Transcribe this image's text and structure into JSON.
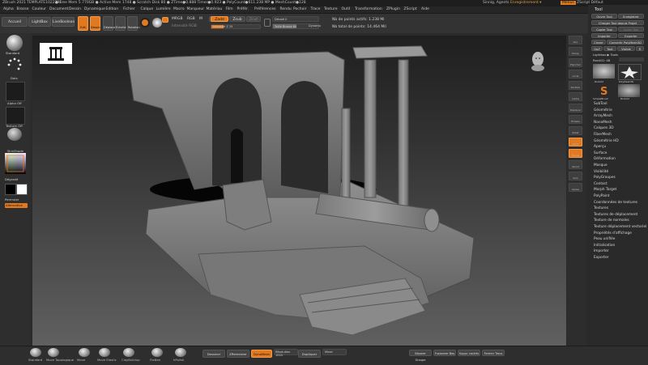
{
  "titlebar": {
    "app": "ZBrush 2021",
    "doc": "TEMPLATE1022291",
    "stats": "● Free Mem 5.770GB ● Active Mem 1748 ● Scratch Disk 80 ● ZTime●0.888 Timer●0.923 ● PolyCount●611.238 MP ● MeshCount●128",
    "right_items": [
      "Sinnig, Agents",
      "Enregistrement ▾",
      "Menus",
      "ZScript Défaut"
    ]
  },
  "menubar": [
    "Alpha",
    "Brosse",
    "Couleur",
    "Document",
    "Dessin",
    "Dynamique",
    "Edition",
    "Fichier",
    "Calque",
    "Lumière",
    "Macro",
    "Marqueur",
    "Matériau",
    "Film",
    "Préfér.",
    "Préférences",
    "Rendu",
    "Pochoir",
    "Trace",
    "Texture",
    "Outil",
    "Transformation",
    "ZPlugin",
    "ZScript",
    "Aide"
  ],
  "topshelf": {
    "tabs": [
      "Accueil",
      "LightBox",
      "LiveBoolean"
    ],
    "tools": [
      "Edit",
      "Dessin",
      "Déplacer",
      "Échelle",
      "Rotation"
    ],
    "mrgb": "MRGB",
    "rgb": "RGB",
    "m": "M",
    "zadd": "Zadd",
    "zsub": "Zsub",
    "zcut": "Zcut",
    "rgb_intensity_label": "Intensité RGB",
    "z_intensity_label": "Intensité Z 25",
    "focal_label": "Décalé 0",
    "draw_size_label": "Taille Brosse 64",
    "dynamic_label": "Dynamic",
    "points_active": "Nb de points actifs: 1.238 Mi",
    "points_total": "Nb total de points: 14.464 Mil"
  },
  "leftshelf": {
    "brush_label": "Standard",
    "stroke_label": "Dots",
    "alpha_label": "Alpha Off",
    "texture_label": "Texture Off",
    "material_label": "SkinShade",
    "gradient_label": "Dégradé",
    "switch_label": "Permuter",
    "alternate_label": "Alternative"
  },
  "rightshelf": [
    "Doc",
    "Persp",
    "Plancher",
    "Local",
    "Position",
    "Cadre",
    "Déplacer",
    "Échelle",
    "Rotat",
    "Polyf",
    "Transp",
    "Ghost",
    "Solo",
    "Xpose"
  ],
  "palette": {
    "title": "Tool",
    "buttons_row1": [
      "Ouvrir Tool",
      "Enregistrer"
    ],
    "buttons_row2": [
      "Charger Tool depuis Projet"
    ],
    "buttons_row3": [
      "Copier Tool",
      "Coller Tool"
    ],
    "buttons_row4": [
      "Importer",
      "Exporter"
    ],
    "buttons_row5": [
      "Cloner",
      "Convertir PolyMesh3D"
    ],
    "buttons_row6": [
      "GoZ",
      "Tout",
      "Visible",
      "R"
    ],
    "lightbox": "Lightbox ▶ Tools",
    "current_tool": "Rock02: 48",
    "thumbs": [
      "Rock02",
      "PolyMesh3D",
      "SimpleBrush",
      "Rock02"
    ],
    "items": [
      "SubTool",
      "Géométrie",
      "ArrayMesh",
      "NanoMesh",
      "Calques 3D",
      "FiberMesh",
      "Géométrie HD",
      "Aperçu",
      "Surface",
      "Déformation",
      "Masque",
      "Visibilité",
      "PolyGroupes",
      "Contact",
      "Morph Target",
      "PolyPaint",
      "Coordonnées de textures",
      "Textures",
      "Textures de déplacement",
      "Texture de normales",
      "Texture déplacement vectoriel",
      "Propriétés d'affichage",
      "Peau unifiée",
      "Initialisation",
      "Importer",
      "Exporter"
    ]
  },
  "bottombar": {
    "brushes": [
      "Standard",
      "Move Topologique",
      "Move",
      "Move Elastic",
      "ClayBuildup",
      "Flatten",
      "hPolish"
    ],
    "buttons": [
      "Dessiner",
      "ZRemesher",
      "DynaMesh",
      "Résolution 1024",
      "Dupliquer",
      "Miroir",
      "Séparer Groupe",
      "Fusionner Bas",
      "Suppr. cachés",
      "Fermer Trous"
    ]
  },
  "colors": {
    "accent": "#e0791f",
    "background": "#2b2b2b",
    "panel": "#333333"
  }
}
